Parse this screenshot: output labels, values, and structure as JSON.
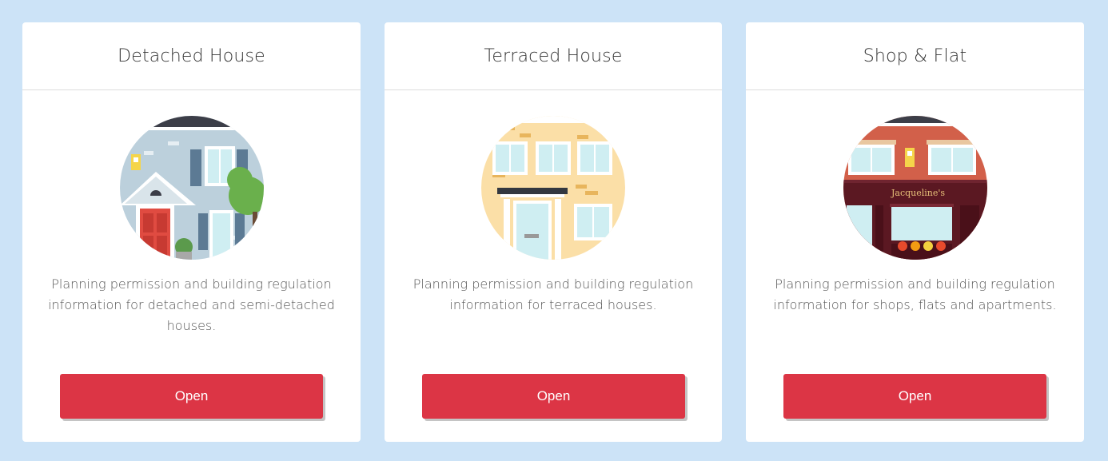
{
  "cards": [
    {
      "title": "Detached House",
      "icon": "detached-house-illustration",
      "description": "Planning permission and building regulation information for detached and semi-detached houses.",
      "button_label": "Open"
    },
    {
      "title": "Terraced House",
      "icon": "terraced-house-illustration",
      "description": "Planning permission and building regulation information for terraced houses.",
      "button_label": "Open"
    },
    {
      "title": "Shop & Flat",
      "icon": "shop-and-flat-illustration",
      "description": "Planning permission and building regulation information for shops, flats and apartments.",
      "shop_sign": "Jacqueline's",
      "button_label": "Open"
    }
  ],
  "colors": {
    "background": "#cce3f7",
    "button": "#dc3545",
    "button_text": "#ffffff"
  }
}
